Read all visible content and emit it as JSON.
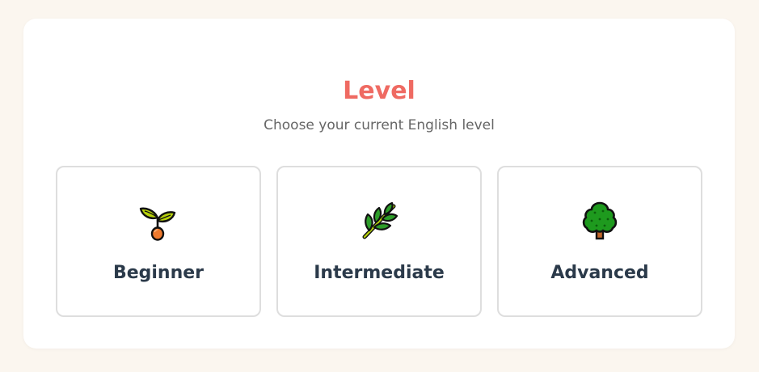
{
  "header": {
    "title": "Level",
    "subtitle": "Choose your current English level"
  },
  "levels": [
    {
      "label": "Beginner",
      "icon": "seedling-icon"
    },
    {
      "label": "Intermediate",
      "icon": "herb-icon"
    },
    {
      "label": "Advanced",
      "icon": "tree-icon"
    }
  ],
  "colors": {
    "page_background": "#fbf6ef",
    "card_background": "#ffffff",
    "title": "#ef6a62",
    "subtitle": "#666666",
    "option_border": "#dedede",
    "option_label": "#2b3a4a"
  }
}
